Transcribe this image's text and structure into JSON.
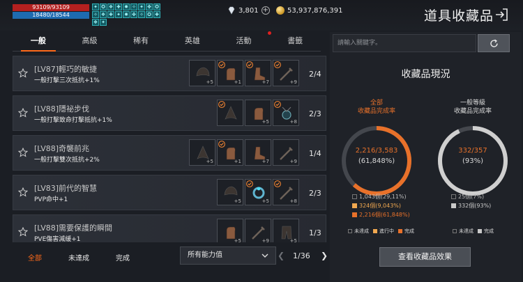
{
  "status": {
    "hp": "93109/93109",
    "mp": "18480/18544"
  },
  "buffs": [
    "✦",
    "✪",
    "❖",
    "✚",
    "✹",
    "✧",
    "✦",
    "✤",
    "✪",
    "✧",
    "❖",
    "✚",
    "✦",
    "✹",
    "✤",
    "✧",
    "✪",
    "✚",
    "❖",
    "✦"
  ],
  "currency": {
    "diamond": "3,801",
    "gold": "53,937,876,391"
  },
  "page_title": "道具收藏品",
  "tabs": [
    {
      "label": "一般",
      "active": true
    },
    {
      "label": "高級",
      "active": false
    },
    {
      "label": "稀有",
      "active": false
    },
    {
      "label": "英雄",
      "active": false
    },
    {
      "label": "活動",
      "active": false
    },
    {
      "label": "書籤",
      "active": false
    }
  ],
  "rows": [
    {
      "title": "[LV87]輕巧的敏捷",
      "desc": "一般打擊三次抵抗+1%",
      "count": "2/4",
      "slots": [
        {
          "check": false,
          "plus": "+5",
          "gear": "helmet"
        },
        {
          "check": true,
          "plus": "+1",
          "gear": "glove"
        },
        {
          "check": true,
          "plus": "+7",
          "gear": "boot"
        },
        {
          "check": true,
          "plus": "+9",
          "gear": "sword"
        }
      ]
    },
    {
      "title": "[LV88]隱祕步伐",
      "desc": "一般打擊致命打擊抵抗+1%",
      "count": "2/3",
      "slots": [
        {
          "empty": true
        },
        {
          "check": true,
          "plus": "",
          "gear": "cone"
        },
        {
          "check": false,
          "plus": "+5",
          "gear": "glove"
        },
        {
          "check": true,
          "plus": "+8",
          "gear": "amulet"
        }
      ]
    },
    {
      "title": "[LV88]奇襲前兆",
      "desc": "一般打擊雙次抵抗+2%",
      "count": "1/4",
      "slots": [
        {
          "check": false,
          "plus": "+5",
          "gear": "cone"
        },
        {
          "check": true,
          "plus": "+1",
          "gear": "glove"
        },
        {
          "check": false,
          "plus": "+7",
          "gear": "boot"
        },
        {
          "check": false,
          "plus": "+9",
          "gear": "sword"
        }
      ]
    },
    {
      "title": "[LV83]前代的智慧",
      "desc": "PVP命中+1",
      "count": "2/3",
      "slots": [
        {
          "empty": true
        },
        {
          "check": false,
          "plus": "+5",
          "gear": "helmet"
        },
        {
          "check": true,
          "plus": "+5",
          "gear": "ring"
        },
        {
          "check": true,
          "plus": "+8",
          "gear": "sword"
        }
      ]
    },
    {
      "title": "[LV88]需要保護的瞬間",
      "desc": "PVE傷害減緩+1",
      "count": "1/3",
      "slots": [
        {
          "empty": true
        },
        {
          "check": false,
          "plus": "+5",
          "gear": "glove"
        },
        {
          "check": false,
          "plus": "+9",
          "gear": "sword"
        },
        {
          "check": false,
          "plus": "+5",
          "gear": "pants"
        }
      ]
    }
  ],
  "filter": {
    "all": "全部",
    "incomplete": "未達成",
    "complete": "完成",
    "select_value": "所有能力值",
    "page": "1/36"
  },
  "side": {
    "search_placeholder": "請輸入關鍵字。",
    "title": "收藏品現況",
    "all": {
      "label_line1": "全部",
      "label_line2": "收藏品完成率",
      "value": "2,216/3,583",
      "percent": "(61,848%)",
      "accent": "#e8712a",
      "stats": [
        "1,043個(29,11%)",
        "324個(9,043%)",
        "2,216個(61,848%)"
      ]
    },
    "normal": {
      "label_line1": "一般等級",
      "label_line2": "收藏品完成率",
      "value": "332/357",
      "percent": "(93%)",
      "accent": "#c9c9c9",
      "stats": [
        "25個(7%)",
        "332個(93%)"
      ]
    },
    "legend_all": [
      "未達成",
      "進行中",
      "完成"
    ],
    "legend_normal": [
      "未達成",
      "完成"
    ],
    "button": "查看收藏品效果"
  }
}
